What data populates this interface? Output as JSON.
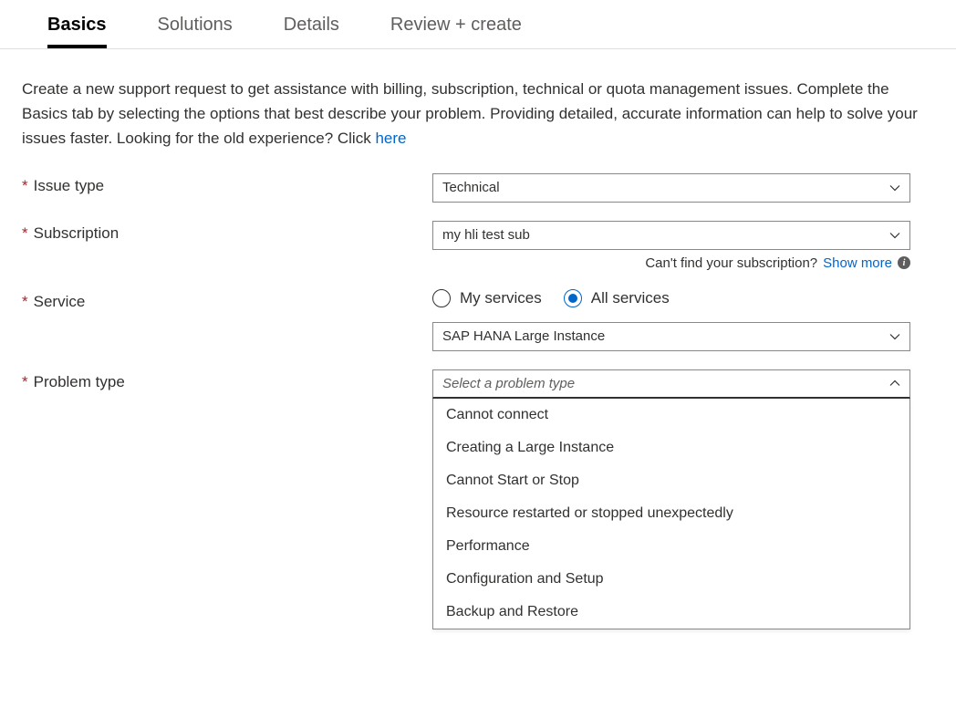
{
  "tabs": {
    "basics": "Basics",
    "solutions": "Solutions",
    "details": "Details",
    "review": "Review + create"
  },
  "intro": {
    "line": "Create a new support request to get assistance with billing, subscription, technical or quota management issues. Complete the Basics tab by selecting the options that best describe your problem. Providing detailed, accurate information can help to solve your issues faster. Looking for the old experience? Click ",
    "link": "here"
  },
  "labels": {
    "issue_type": "Issue type",
    "subscription": "Subscription",
    "service": "Service",
    "problem_type": "Problem type"
  },
  "values": {
    "issue_type": "Technical",
    "subscription": "my hli test sub",
    "service_name": "SAP HANA Large Instance",
    "problem_placeholder": "Select a problem type"
  },
  "subscription_help": {
    "prefix": "Can't find your subscription? ",
    "link": "Show more"
  },
  "service_scope": {
    "my": "My services",
    "all": "All services"
  },
  "problem_options": [
    "Cannot connect",
    "Creating a Large Instance",
    "Cannot Start or Stop",
    "Resource restarted or stopped unexpectedly",
    "Performance",
    "Configuration and Setup",
    "Backup and Restore"
  ]
}
